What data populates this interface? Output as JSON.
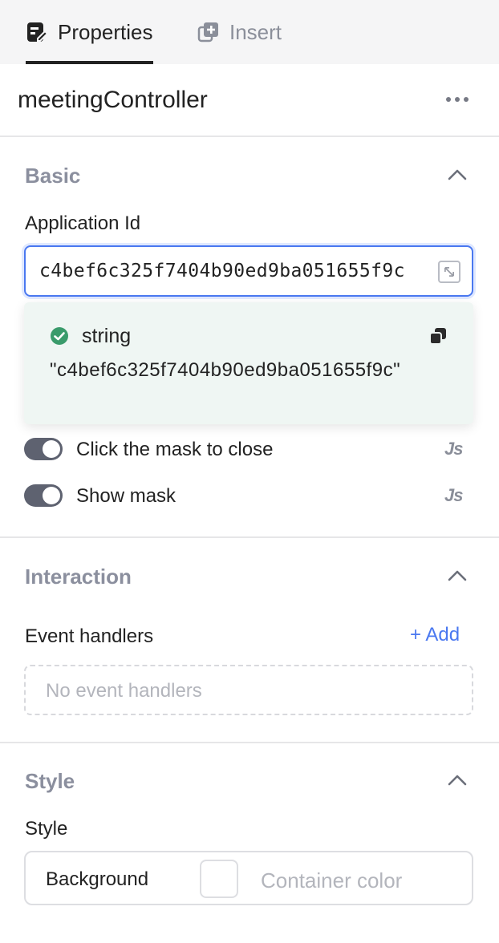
{
  "tabs": [
    {
      "label": "Properties",
      "icon": "properties-icon",
      "active": true
    },
    {
      "label": "Insert",
      "icon": "insert-icon",
      "active": false
    }
  ],
  "component": {
    "name": "meetingController",
    "more_icon": "more-icon"
  },
  "basic": {
    "title": "Basic",
    "application_id": {
      "label": "Application Id",
      "value": "c4bef6c325f7404b90ed9ba051655f9c"
    },
    "popover": {
      "type": "string",
      "value": "\"c4bef6c325f7404b90ed9ba051655f9c\""
    },
    "toggles": [
      {
        "label": "Click the mask to close",
        "on": true,
        "js_label": "Js"
      },
      {
        "label": "Show mask",
        "on": true,
        "js_label": "Js"
      }
    ]
  },
  "interaction": {
    "title": "Interaction",
    "event_handlers_label": "Event handlers",
    "add_label": "+ Add",
    "empty_text": "No event handlers"
  },
  "style": {
    "title": "Style",
    "label": "Style",
    "background_label": "Background",
    "color_placeholder": "Container color"
  },
  "colors": {
    "accent": "#4a78f0",
    "success": "#3a9b6b",
    "popover_bg": "#eff6f3",
    "switch_on": "#5e6270"
  }
}
